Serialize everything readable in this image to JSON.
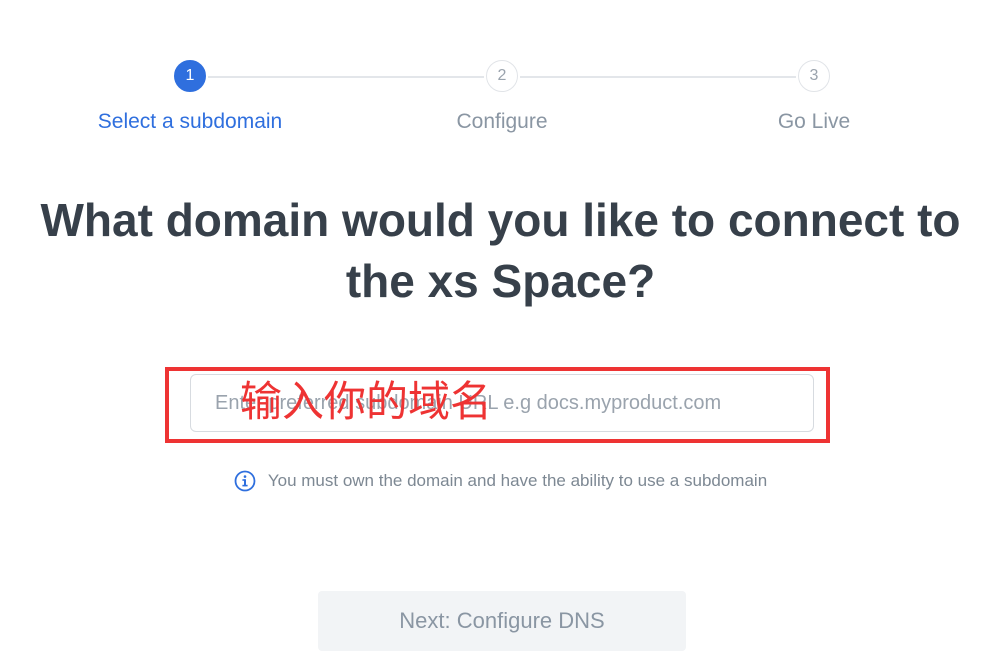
{
  "stepper": {
    "steps": [
      {
        "number": "1",
        "label": "Select a subdomain",
        "state": "active"
      },
      {
        "number": "2",
        "label": "Configure",
        "state": "inactive"
      },
      {
        "number": "3",
        "label": "Go Live",
        "state": "inactive"
      }
    ],
    "accent_color": "#2f6fde"
  },
  "main": {
    "headline": "What domain would you like to connect to the xs Space?",
    "domain_input": {
      "value": "",
      "placeholder": "Enter preferred subdomain URL e.g docs.myproduct.com"
    },
    "annotation": {
      "text": "输入你的域名",
      "color": "#ee3333"
    },
    "hint": {
      "icon": "info-circle-icon",
      "text": "You must own the domain and have the ability to use a subdomain"
    },
    "next_button": {
      "label": "Next: Configure DNS",
      "state": "disabled"
    }
  }
}
